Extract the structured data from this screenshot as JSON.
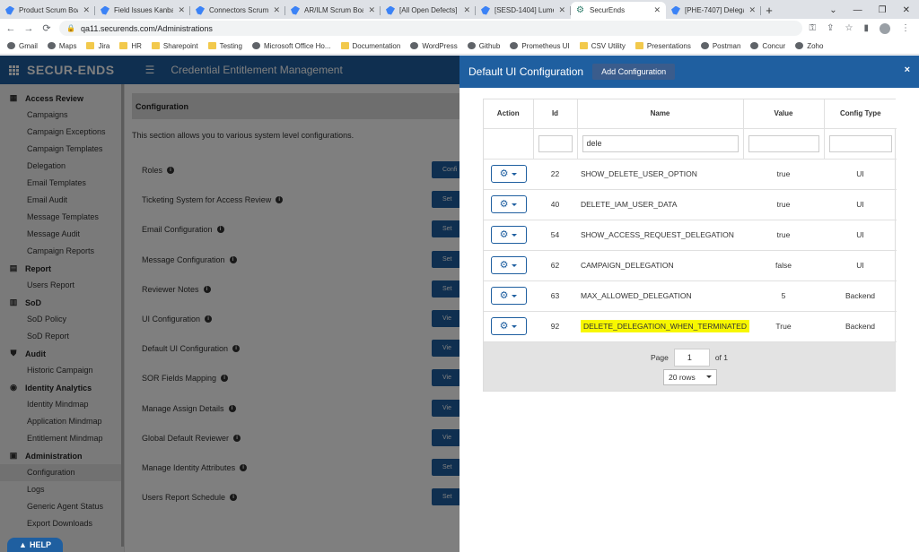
{
  "browser": {
    "tabs": [
      {
        "label": "Product Scrum Boar",
        "active": false
      },
      {
        "label": "Field Issues Kanban",
        "active": false
      },
      {
        "label": "Connectors Scrum B",
        "active": false
      },
      {
        "label": "AR/ILM Scrum Boar",
        "active": false
      },
      {
        "label": "[All Open Defects] |",
        "active": false
      },
      {
        "label": "[SESD-1404] Lumeri",
        "active": false
      },
      {
        "label": "SecurEnds",
        "active": true
      },
      {
        "label": "[PHE-7407] Delegati",
        "active": false
      }
    ],
    "url": "qa11.securends.com/Administrations",
    "bookmarks": [
      "Gmail",
      "Maps",
      "Jira",
      "HR",
      "Sharepoint",
      "Testing",
      "Microsoft Office Ho...",
      "Documentation",
      "WordPress",
      "Github",
      "Prometheus UI",
      "CSV Utility",
      "Presentations",
      "Postman",
      "Concur",
      "Zoho"
    ]
  },
  "app": {
    "logo": "SECUR-ENDS",
    "title": "Credential Entitlement Management"
  },
  "sidebar": {
    "sections": [
      {
        "label": "Access Review",
        "icon": "grid-icon",
        "items": [
          "Campaigns",
          "Campaign Exceptions",
          "Campaign Templates",
          "Delegation",
          "Email Templates",
          "Email Audit",
          "Message Templates",
          "Message Audit",
          "Campaign Reports"
        ]
      },
      {
        "label": "Report",
        "icon": "report-icon",
        "items": [
          "Users Report"
        ]
      },
      {
        "label": "SoD",
        "icon": "sod-icon",
        "items": [
          "SoD Policy",
          "SoD Report"
        ]
      },
      {
        "label": "Audit",
        "icon": "shield-icon",
        "items": [
          "Historic Campaign"
        ]
      },
      {
        "label": "Identity Analytics",
        "icon": "analytics-icon",
        "items": [
          "Identity Mindmap",
          "Application Mindmap",
          "Entitlement Mindmap"
        ]
      },
      {
        "label": "Administration",
        "icon": "admin-icon",
        "items": [
          "Configuration",
          "Logs",
          "Generic Agent Status",
          "Export Downloads"
        ]
      }
    ],
    "active_item": "Configuration"
  },
  "main": {
    "header": "Configuration",
    "description": "This section allows you to various system level configurations.",
    "rows": [
      {
        "label": "Roles",
        "button": "Confi"
      },
      {
        "label": "Ticketing System for Access Review",
        "button": "Set"
      },
      {
        "label": "Email Configuration",
        "button": "Set"
      },
      {
        "label": "Message Configuration",
        "button": "Set"
      },
      {
        "label": "Reviewer Notes",
        "button": "Set"
      },
      {
        "label": "UI Configuration",
        "button": "Vie"
      },
      {
        "label": "Default UI Configuration",
        "button": "Vie"
      },
      {
        "label": "SOR Fields Mapping",
        "button": "Vie"
      },
      {
        "label": "Manage Assign Details",
        "button": "Vie"
      },
      {
        "label": "Global Default Reviewer",
        "button": "Vie"
      },
      {
        "label": "Manage Identity Attributes",
        "button": "Set"
      },
      {
        "label": "Users Report Schedule",
        "button": "Set"
      }
    ]
  },
  "help": {
    "label": "HELP"
  },
  "drawer": {
    "title": "Default UI Configuration",
    "add_button": "Add Configuration",
    "close": "×",
    "columns": [
      "Action",
      "Id",
      "Name",
      "Value",
      "Config Type"
    ],
    "filter": {
      "name": "dele"
    },
    "rows": [
      {
        "id": "22",
        "name": "SHOW_DELETE_USER_OPTION",
        "value": "true",
        "type": "UI",
        "highlight": false
      },
      {
        "id": "40",
        "name": "DELETE_IAM_USER_DATA",
        "value": "true",
        "type": "UI",
        "highlight": false
      },
      {
        "id": "54",
        "name": "SHOW_ACCESS_REQUEST_DELEGATION",
        "value": "true",
        "type": "UI",
        "highlight": false
      },
      {
        "id": "62",
        "name": "CAMPAIGN_DELEGATION",
        "value": "false",
        "type": "UI",
        "highlight": false
      },
      {
        "id": "63",
        "name": "MAX_ALLOWED_DELEGATION",
        "value": "5",
        "type": "Backend",
        "highlight": false
      },
      {
        "id": "92",
        "name": "DELETE_DELEGATION_WHEN_TERMINATED",
        "value": "True",
        "type": "Backend",
        "highlight": true
      }
    ],
    "pager": {
      "page_label": "Page",
      "page": "1",
      "of_label": "of 1",
      "rows_option": "20 rows"
    },
    "highlight_color": "#f7f700"
  }
}
